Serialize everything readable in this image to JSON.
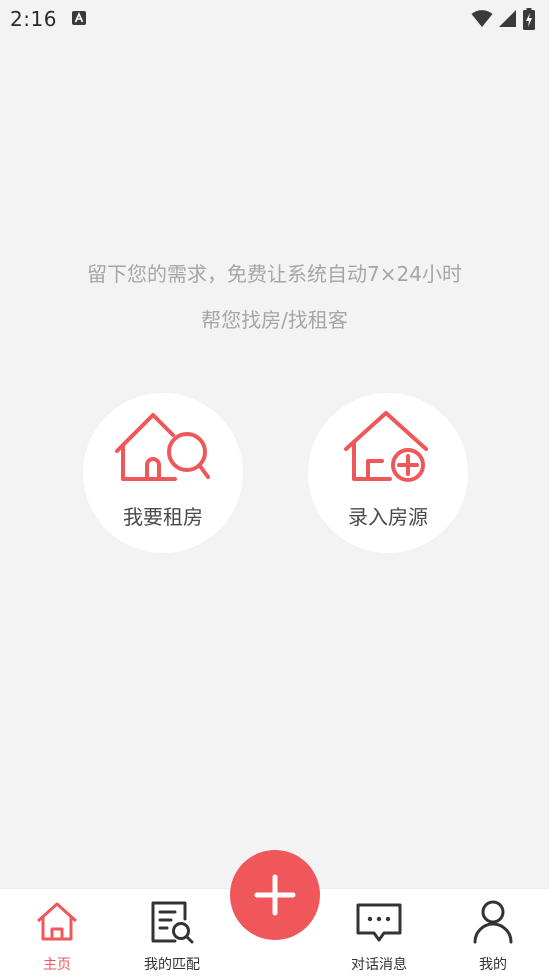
{
  "status_bar": {
    "time": "2:16",
    "icons": [
      "a-icon",
      "wifi-icon",
      "signal-icon",
      "battery-charging-icon"
    ]
  },
  "intro": {
    "line1": "留下您的需求，免费让系统自动7×24小时",
    "line2": "帮您找房/找租客"
  },
  "actions": {
    "rent": {
      "label": "我要租房",
      "icon": "house-search-icon"
    },
    "enter": {
      "label": "录入房源",
      "icon": "house-add-icon"
    }
  },
  "tabbar": {
    "home": {
      "label": "主页",
      "icon": "home-icon",
      "active": true
    },
    "match": {
      "label": "我的匹配",
      "icon": "document-search-icon"
    },
    "fab": {
      "icon": "plus-icon"
    },
    "chat": {
      "label": "对话消息",
      "icon": "chat-bubble-icon"
    },
    "me": {
      "label": "我的",
      "icon": "user-icon"
    }
  },
  "colors": {
    "accent": "#f0575a",
    "background": "#f3f3f3",
    "hint_text": "#a6a6a6"
  }
}
